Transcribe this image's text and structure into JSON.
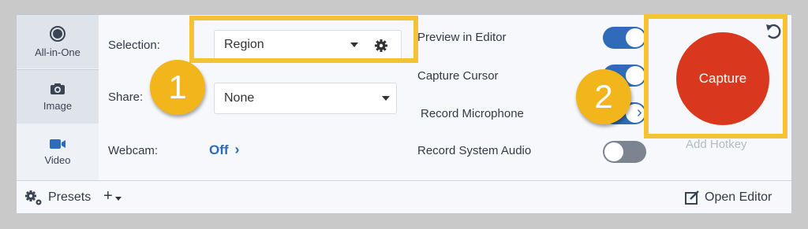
{
  "modes": [
    {
      "label": "All-in-One",
      "icon": "all-in-one-icon"
    },
    {
      "label": "Image",
      "icon": "camera-icon"
    },
    {
      "label": "Video",
      "icon": "video-camera-icon"
    }
  ],
  "selection": {
    "label": "Selection:",
    "value": "Region"
  },
  "share": {
    "label": "Share:",
    "value": "None"
  },
  "webcam": {
    "label": "Webcam:",
    "value": "Off"
  },
  "options": [
    {
      "label": "Preview in Editor",
      "state": "on"
    },
    {
      "label": "Capture Cursor",
      "state": "on"
    },
    {
      "label": "Record Microphone",
      "state": "on"
    },
    {
      "label": "Record System Audio",
      "state": "off"
    }
  ],
  "capture": {
    "label": "Capture",
    "hotkey": "Add Hotkey"
  },
  "bottom": {
    "presets": "Presets",
    "add": "+",
    "open_editor": "Open Editor"
  },
  "annotations": {
    "badge1": "1",
    "badge2": "2",
    "highlight_color": "#f4c333"
  },
  "colors": {
    "accent": "#2f6bb8",
    "capture": "#d9371e",
    "badge": "#f3b51c"
  }
}
